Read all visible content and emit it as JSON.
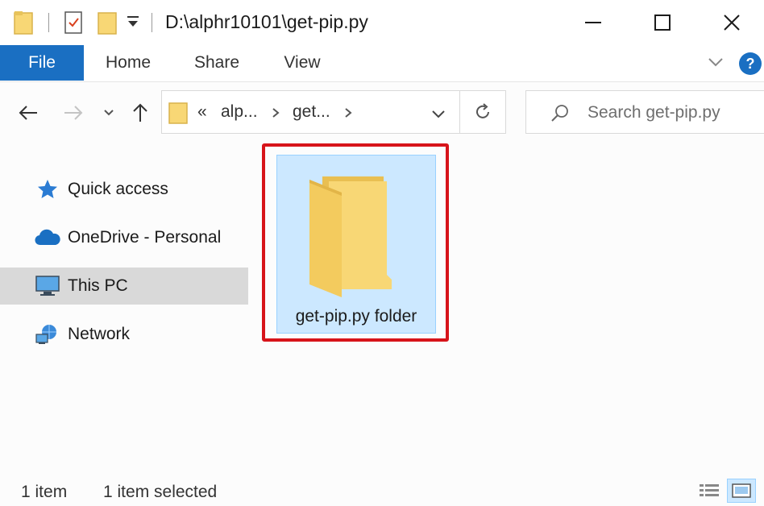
{
  "titlebar": {
    "title": "D:\\alphr10101\\get-pip.py",
    "quick_access_icons": [
      "folder-icon",
      "properties-icon",
      "new-folder-icon",
      "customize-dropdown-icon"
    ],
    "window_buttons": [
      "minimize-icon",
      "maximize-icon",
      "close-icon"
    ]
  },
  "ribbon": {
    "tabs": [
      {
        "label": "File"
      },
      {
        "label": "Home"
      },
      {
        "label": "Share"
      },
      {
        "label": "View"
      }
    ]
  },
  "navbar": {
    "breadcrumb_chevron": "«",
    "crumbs": [
      "alp...",
      "get..."
    ],
    "search_placeholder": "Search get-pip.py"
  },
  "navpane": {
    "items": [
      {
        "label": "Quick access",
        "icon": "star-icon"
      },
      {
        "label": "OneDrive - Personal",
        "icon": "cloud-icon"
      },
      {
        "label": "This PC",
        "icon": "monitor-icon",
        "selected": true
      },
      {
        "label": "Network",
        "icon": "network-icon"
      }
    ]
  },
  "content": {
    "items": [
      {
        "label": "get-pip.py folder",
        "icon": "folder-icon",
        "selected": true
      }
    ]
  },
  "status": {
    "count": "1 item",
    "selected": "1 item selected"
  },
  "colors": {
    "accent": "#1a6fc2",
    "selection": "#cce8ff",
    "highlight_box": "#d7141a",
    "folder": "#f8d775"
  }
}
